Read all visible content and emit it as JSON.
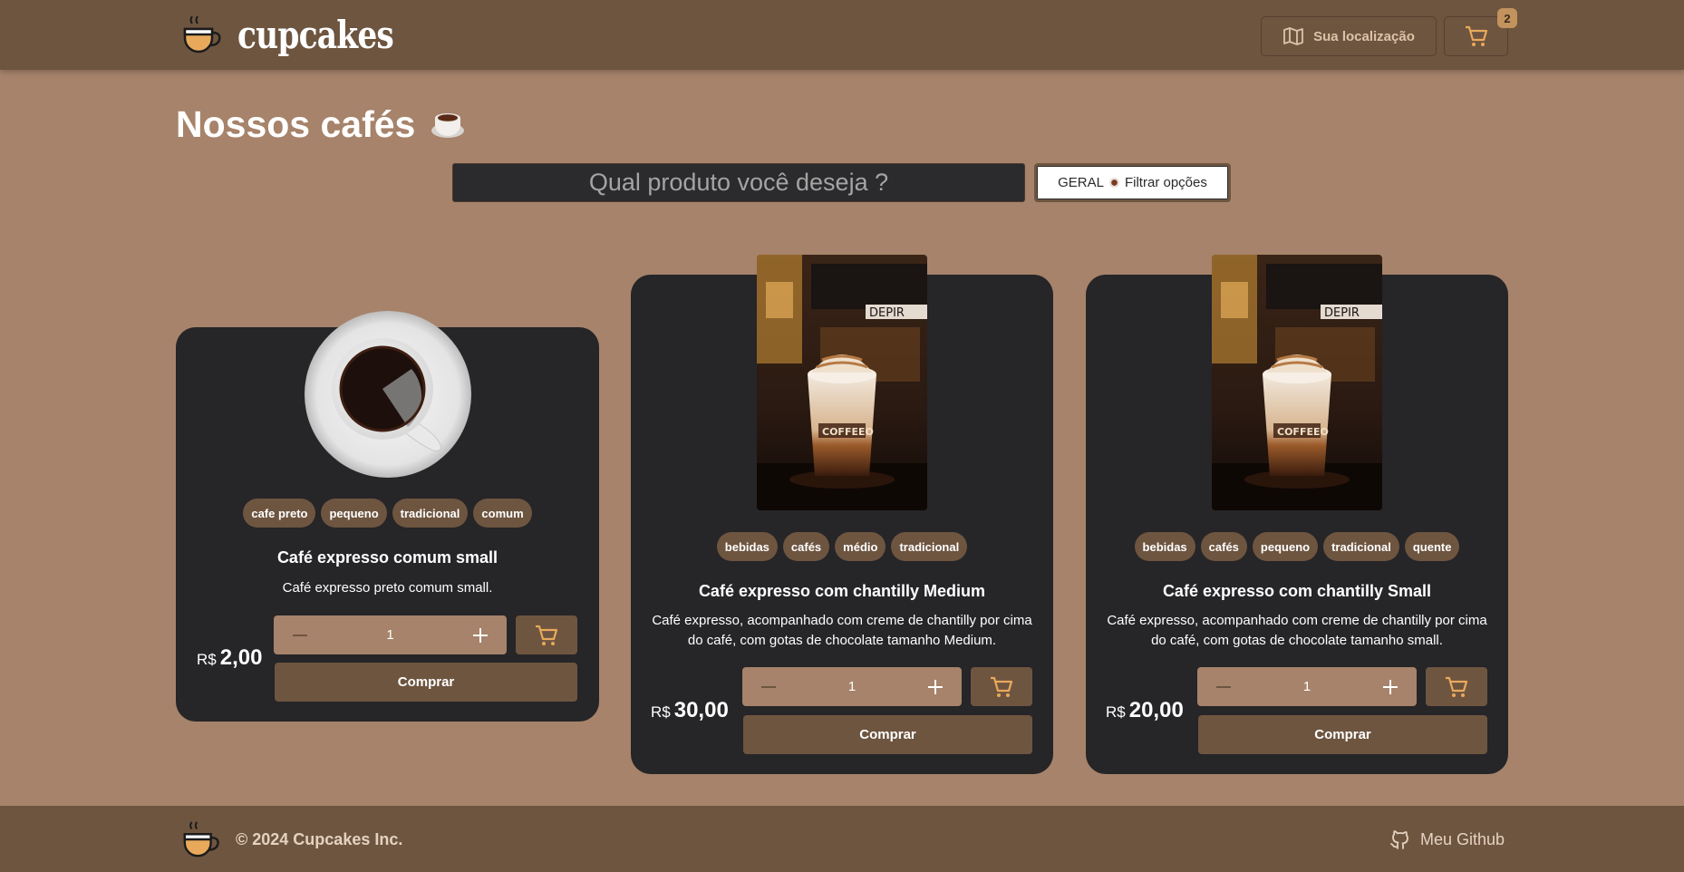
{
  "header": {
    "logo_text": "cupcakes",
    "location_label": "Sua localização",
    "cart_count": "2"
  },
  "page": {
    "title": "Nossos cafés"
  },
  "search": {
    "placeholder": "Qual produto você deseja ?"
  },
  "filter": {
    "category": "GERAL",
    "label": "Filtrar opções"
  },
  "products": [
    {
      "tags": [
        "cafe preto",
        "pequeno",
        "tradicional",
        "comum"
      ],
      "name": "Café expresso comum small",
      "description": "Café expresso preto comum small.",
      "currency": "R$",
      "price": "2,00",
      "quantity": "1",
      "buy_label": "Comprar"
    },
    {
      "tags": [
        "bebidas",
        "cafés",
        "médio",
        "tradicional"
      ],
      "name": "Café expresso com chantilly Medium",
      "description": "Café expresso, acompanhado com creme de chantilly por cima do café, com gotas de chocolate tamanho Medium.",
      "currency": "R$",
      "price": "30,00",
      "quantity": "1",
      "buy_label": "Comprar"
    },
    {
      "tags": [
        "bebidas",
        "cafés",
        "pequeno",
        "tradicional",
        "quente"
      ],
      "name": "Café expresso com chantilly Small",
      "description": "Café expresso, acompanhado com creme de chantilly por cima do café, com gotas de chocolate tamanho small.",
      "currency": "R$",
      "price": "20,00",
      "quantity": "1",
      "buy_label": "Comprar"
    }
  ],
  "footer": {
    "copyright": "© 2024 Cupcakes Inc.",
    "github_label": "Meu Github"
  },
  "colors": {
    "background": "#a6836a",
    "header": "#6e5540",
    "card": "#262528",
    "accent": "#c3935d"
  },
  "icons": {
    "logo": "coffee-cup-icon",
    "location": "map-icon",
    "cart": "cart-icon",
    "github": "github-icon"
  }
}
